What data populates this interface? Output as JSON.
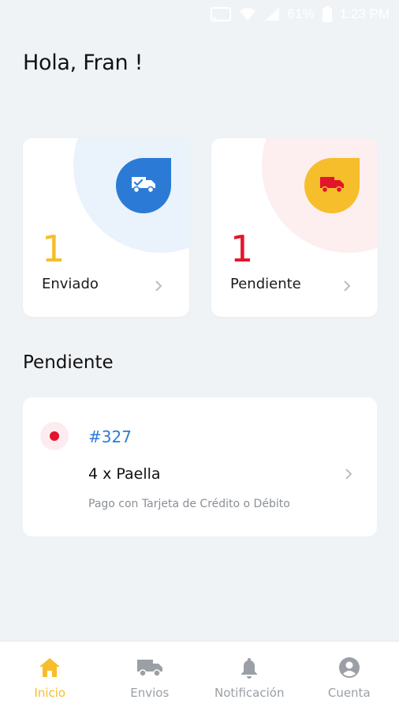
{
  "status_bar": {
    "battery": "61%",
    "time": "1:23 PM"
  },
  "greeting": "Hola, Fran !",
  "summary_cards": [
    {
      "count": "1",
      "label": "Enviado",
      "icon": "truck-check-icon",
      "accent": "#2b7bd6",
      "count_color": "#f6be2b",
      "blob_color": "#eaf3fc"
    },
    {
      "count": "1",
      "label": "Pendiente",
      "icon": "truck-icon",
      "accent": "#f6be2b",
      "count_color": "#e3142b",
      "blob_color": "#fdeef0"
    }
  ],
  "pending_section": {
    "title": "Pendiente",
    "orders": [
      {
        "id": "#327",
        "items": "4 x Paella",
        "payment": "Pago con Tarjeta de Crédito o Débito",
        "status_color": "#e3142b"
      }
    ]
  },
  "bottom_nav": {
    "active_color": "#f6be2b",
    "inactive_color": "#9aa0a6",
    "items": [
      {
        "label": "Inicio",
        "icon": "home-icon",
        "active": true
      },
      {
        "label": "Envios",
        "icon": "truck-icon",
        "active": false
      },
      {
        "label": "Notificación",
        "icon": "bell-icon",
        "active": false
      },
      {
        "label": "Cuenta",
        "icon": "account-icon",
        "active": false
      }
    ]
  }
}
